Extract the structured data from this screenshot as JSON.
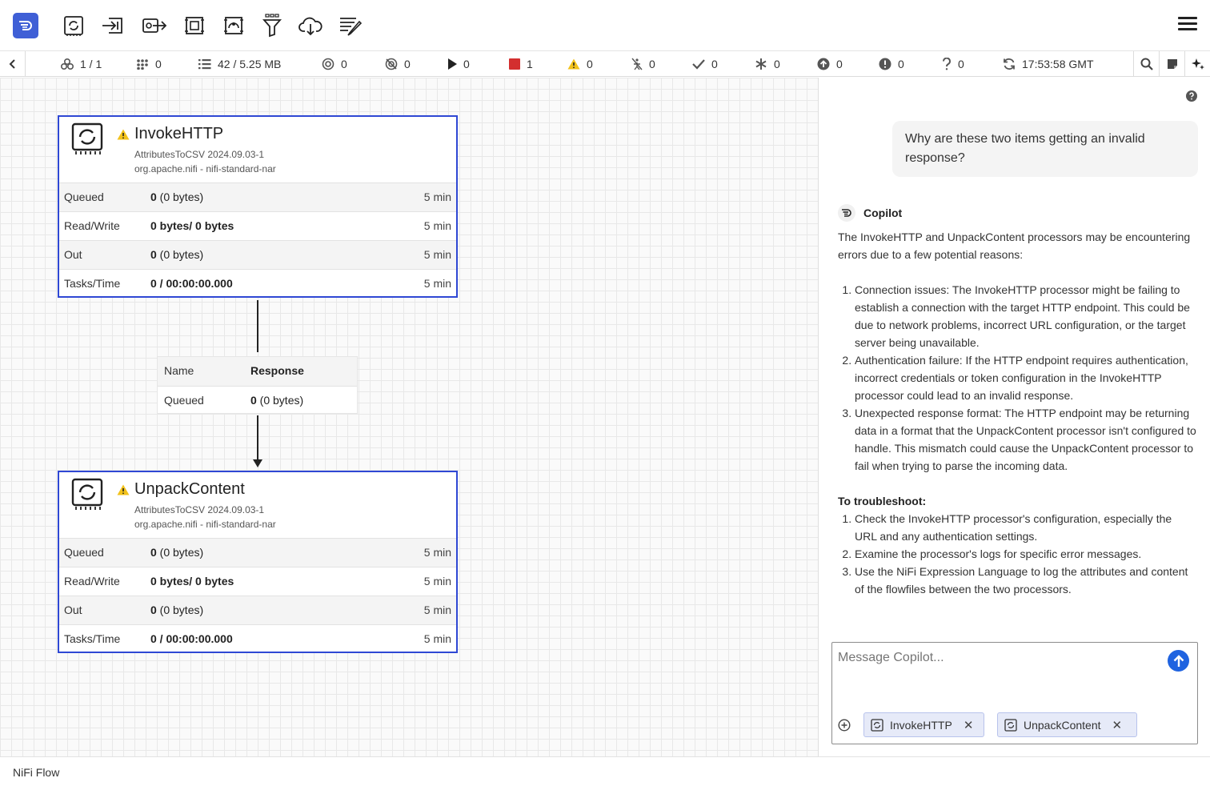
{
  "toolbar": {
    "tools": [
      "processor-icon",
      "input-port-icon",
      "output-port-icon",
      "process-group-icon",
      "remote-process-group-icon",
      "funnel-icon",
      "import-cloud-icon",
      "label-icon"
    ]
  },
  "status": {
    "threads": "1 / 1",
    "tasks": "0",
    "queued": "42 / 5.25 MB",
    "transmitting": "0",
    "not_transmitting": "0",
    "running": "0",
    "stopped": "1",
    "invalid": "0",
    "disabled": "0",
    "up_to_date": "0",
    "locally_modified": "0",
    "stale": "0",
    "errors": "0",
    "sync_failure": "0",
    "last_refresh": "17:53:58 GMT"
  },
  "processors": [
    {
      "name": "InvokeHTTP",
      "type": "AttributesToCSV 2024.09.03-1",
      "bundle": "org.apache.nifi - nifi-standard-nar",
      "rows": [
        {
          "label": "Queued",
          "bold": "0",
          "rest": " (0 bytes)",
          "time": "5 min"
        },
        {
          "label": "Read/Write",
          "bold": "0 bytes/ 0 bytes",
          "rest": "",
          "time": "5 min"
        },
        {
          "label": "Out",
          "bold": "0",
          "rest": " (0 bytes)",
          "time": "5 min"
        },
        {
          "label": "Tasks/Time",
          "bold": "0 / 00:00:00.000",
          "rest": "",
          "time": "5 min"
        }
      ]
    },
    {
      "name": "UnpackContent",
      "type": "AttributesToCSV 2024.09.03-1",
      "bundle": "org.apache.nifi - nifi-standard-nar",
      "rows": [
        {
          "label": "Queued",
          "bold": "0",
          "rest": " (0 bytes)",
          "time": "5 min"
        },
        {
          "label": "Read/Write",
          "bold": "0 bytes/ 0 bytes",
          "rest": "",
          "time": "5 min"
        },
        {
          "label": "Out",
          "bold": "0",
          "rest": " (0 bytes)",
          "time": "5 min"
        },
        {
          "label": "Tasks/Time",
          "bold": "0 / 00:00:00.000",
          "rest": "",
          "time": "5 min"
        }
      ]
    }
  ],
  "connection": {
    "name_label": "Name",
    "name_value": "Response",
    "queued_label": "Queued",
    "queued_bold": "0",
    "queued_rest": " (0 bytes)"
  },
  "copilot": {
    "user_message": "Why are these two items getting an invalid response?",
    "assistant_name": "Copilot",
    "intro": "The InvokeHTTP and UnpackContent processors may be encountering errors due to a few potential reasons:",
    "reasons": [
      "Connection issues: The InvokeHTTP processor might be failing to establish a connection with the target HTTP endpoint. This could be due to network problems, incorrect URL configuration, or the target server being unavailable.",
      "Authentication failure: If the HTTP endpoint requires authentication, incorrect credentials or token configuration in the InvokeHTTP processor could lead to an invalid response.",
      "Unexpected response format: The HTTP endpoint may be returning data in a format that the UnpackContent processor isn't configured to handle. This mismatch could cause the UnpackContent processor to fail when trying to parse the incoming data."
    ],
    "troubleshoot_title": "To troubleshoot:",
    "steps": [
      "Check the InvokeHTTP processor's configuration, especially the URL and any authentication settings.",
      "Examine the processor's logs for specific error messages.",
      "Use the NiFi Expression Language to log the attributes and content of the flowfiles between the two processors."
    ],
    "input_placeholder": "Message Copilot...",
    "context_chips": [
      "InvokeHTTP",
      "UnpackContent"
    ]
  },
  "breadcrumb": "NiFi Flow",
  "colors": {
    "accent": "#2f48d4",
    "send": "#1f63e0",
    "warning": "#f2c21b",
    "stopped": "#d32f2f"
  }
}
